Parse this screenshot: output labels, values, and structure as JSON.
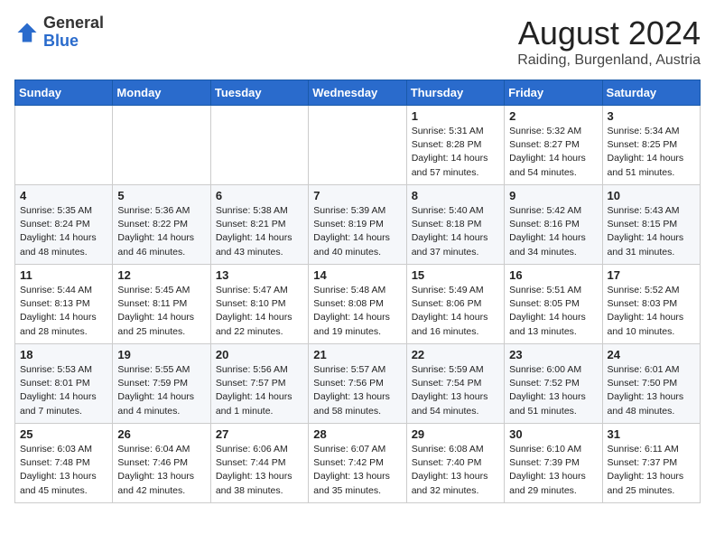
{
  "header": {
    "logo_general": "General",
    "logo_blue": "Blue",
    "month_year": "August 2024",
    "location": "Raiding, Burgenland, Austria"
  },
  "days_of_week": [
    "Sunday",
    "Monday",
    "Tuesday",
    "Wednesday",
    "Thursday",
    "Friday",
    "Saturday"
  ],
  "weeks": [
    [
      {
        "day": "",
        "content": ""
      },
      {
        "day": "",
        "content": ""
      },
      {
        "day": "",
        "content": ""
      },
      {
        "day": "",
        "content": ""
      },
      {
        "day": "1",
        "content": "Sunrise: 5:31 AM\nSunset: 8:28 PM\nDaylight: 14 hours\nand 57 minutes."
      },
      {
        "day": "2",
        "content": "Sunrise: 5:32 AM\nSunset: 8:27 PM\nDaylight: 14 hours\nand 54 minutes."
      },
      {
        "day": "3",
        "content": "Sunrise: 5:34 AM\nSunset: 8:25 PM\nDaylight: 14 hours\nand 51 minutes."
      }
    ],
    [
      {
        "day": "4",
        "content": "Sunrise: 5:35 AM\nSunset: 8:24 PM\nDaylight: 14 hours\nand 48 minutes."
      },
      {
        "day": "5",
        "content": "Sunrise: 5:36 AM\nSunset: 8:22 PM\nDaylight: 14 hours\nand 46 minutes."
      },
      {
        "day": "6",
        "content": "Sunrise: 5:38 AM\nSunset: 8:21 PM\nDaylight: 14 hours\nand 43 minutes."
      },
      {
        "day": "7",
        "content": "Sunrise: 5:39 AM\nSunset: 8:19 PM\nDaylight: 14 hours\nand 40 minutes."
      },
      {
        "day": "8",
        "content": "Sunrise: 5:40 AM\nSunset: 8:18 PM\nDaylight: 14 hours\nand 37 minutes."
      },
      {
        "day": "9",
        "content": "Sunrise: 5:42 AM\nSunset: 8:16 PM\nDaylight: 14 hours\nand 34 minutes."
      },
      {
        "day": "10",
        "content": "Sunrise: 5:43 AM\nSunset: 8:15 PM\nDaylight: 14 hours\nand 31 minutes."
      }
    ],
    [
      {
        "day": "11",
        "content": "Sunrise: 5:44 AM\nSunset: 8:13 PM\nDaylight: 14 hours\nand 28 minutes."
      },
      {
        "day": "12",
        "content": "Sunrise: 5:45 AM\nSunset: 8:11 PM\nDaylight: 14 hours\nand 25 minutes."
      },
      {
        "day": "13",
        "content": "Sunrise: 5:47 AM\nSunset: 8:10 PM\nDaylight: 14 hours\nand 22 minutes."
      },
      {
        "day": "14",
        "content": "Sunrise: 5:48 AM\nSunset: 8:08 PM\nDaylight: 14 hours\nand 19 minutes."
      },
      {
        "day": "15",
        "content": "Sunrise: 5:49 AM\nSunset: 8:06 PM\nDaylight: 14 hours\nand 16 minutes."
      },
      {
        "day": "16",
        "content": "Sunrise: 5:51 AM\nSunset: 8:05 PM\nDaylight: 14 hours\nand 13 minutes."
      },
      {
        "day": "17",
        "content": "Sunrise: 5:52 AM\nSunset: 8:03 PM\nDaylight: 14 hours\nand 10 minutes."
      }
    ],
    [
      {
        "day": "18",
        "content": "Sunrise: 5:53 AM\nSunset: 8:01 PM\nDaylight: 14 hours\nand 7 minutes."
      },
      {
        "day": "19",
        "content": "Sunrise: 5:55 AM\nSunset: 7:59 PM\nDaylight: 14 hours\nand 4 minutes."
      },
      {
        "day": "20",
        "content": "Sunrise: 5:56 AM\nSunset: 7:57 PM\nDaylight: 14 hours\nand 1 minute."
      },
      {
        "day": "21",
        "content": "Sunrise: 5:57 AM\nSunset: 7:56 PM\nDaylight: 13 hours\nand 58 minutes."
      },
      {
        "day": "22",
        "content": "Sunrise: 5:59 AM\nSunset: 7:54 PM\nDaylight: 13 hours\nand 54 minutes."
      },
      {
        "day": "23",
        "content": "Sunrise: 6:00 AM\nSunset: 7:52 PM\nDaylight: 13 hours\nand 51 minutes."
      },
      {
        "day": "24",
        "content": "Sunrise: 6:01 AM\nSunset: 7:50 PM\nDaylight: 13 hours\nand 48 minutes."
      }
    ],
    [
      {
        "day": "25",
        "content": "Sunrise: 6:03 AM\nSunset: 7:48 PM\nDaylight: 13 hours\nand 45 minutes."
      },
      {
        "day": "26",
        "content": "Sunrise: 6:04 AM\nSunset: 7:46 PM\nDaylight: 13 hours\nand 42 minutes."
      },
      {
        "day": "27",
        "content": "Sunrise: 6:06 AM\nSunset: 7:44 PM\nDaylight: 13 hours\nand 38 minutes."
      },
      {
        "day": "28",
        "content": "Sunrise: 6:07 AM\nSunset: 7:42 PM\nDaylight: 13 hours\nand 35 minutes."
      },
      {
        "day": "29",
        "content": "Sunrise: 6:08 AM\nSunset: 7:40 PM\nDaylight: 13 hours\nand 32 minutes."
      },
      {
        "day": "30",
        "content": "Sunrise: 6:10 AM\nSunset: 7:39 PM\nDaylight: 13 hours\nand 29 minutes."
      },
      {
        "day": "31",
        "content": "Sunrise: 6:11 AM\nSunset: 7:37 PM\nDaylight: 13 hours\nand 25 minutes."
      }
    ]
  ]
}
